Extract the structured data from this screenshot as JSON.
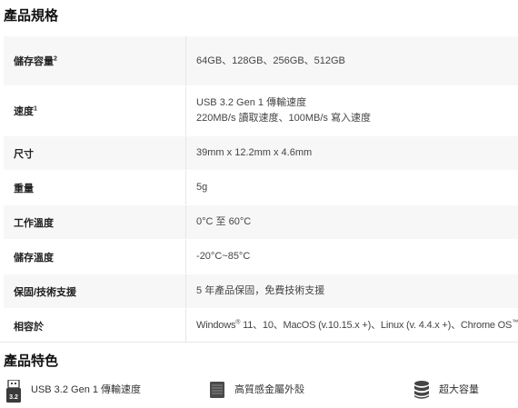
{
  "spec_section": {
    "title": "產品規格",
    "rows": [
      {
        "label": "儲存容量",
        "sup": "2",
        "lines": [
          "64GB、128GB、256GB、512GB"
        ],
        "sup_after": ""
      },
      {
        "label": "速度",
        "sup": "1",
        "lines": [
          "USB 3.2 Gen 1 傳輸速度",
          "220MB/s 讀取速度、100MB/s 寫入速度"
        ],
        "sup_after": ""
      },
      {
        "label": "尺寸",
        "sup": "",
        "lines": [
          "39mm x 12.2mm x 4.6mm"
        ],
        "sup_after": ""
      },
      {
        "label": "重量",
        "sup": "",
        "lines": [
          "5g"
        ],
        "sup_after": ""
      },
      {
        "label": "工作溫度",
        "sup": "",
        "lines": [
          "0°C 至 60°C"
        ],
        "sup_after": ""
      },
      {
        "label": "儲存溫度",
        "sup": "",
        "lines": [
          "-20°C~85°C"
        ],
        "sup_after": ""
      },
      {
        "label": "保固/技術支援",
        "sup": "",
        "lines": [
          "5 年產品保固，免費技術支援"
        ],
        "sup_after": ""
      },
      {
        "label": "相容於",
        "sup": "",
        "lines": [],
        "compat": {
          "a": "Windows",
          "a_sup": "®",
          "b": " 11、10、MacOS (v.10.15.x +)、Linux (v. 4.4.x +)、Chrome OS",
          "b_sup": "™"
        }
      }
    ]
  },
  "features_section": {
    "title": "產品特色",
    "items": [
      {
        "label": "USB 3.2 Gen 1 傳輸速度",
        "icon": "usb-speed-icon",
        "badge": "3.2"
      },
      {
        "label": "高質感金屬外殼",
        "icon": "metal-casing-icon"
      },
      {
        "label": "超大容量",
        "icon": "database-stack-icon"
      }
    ]
  }
}
